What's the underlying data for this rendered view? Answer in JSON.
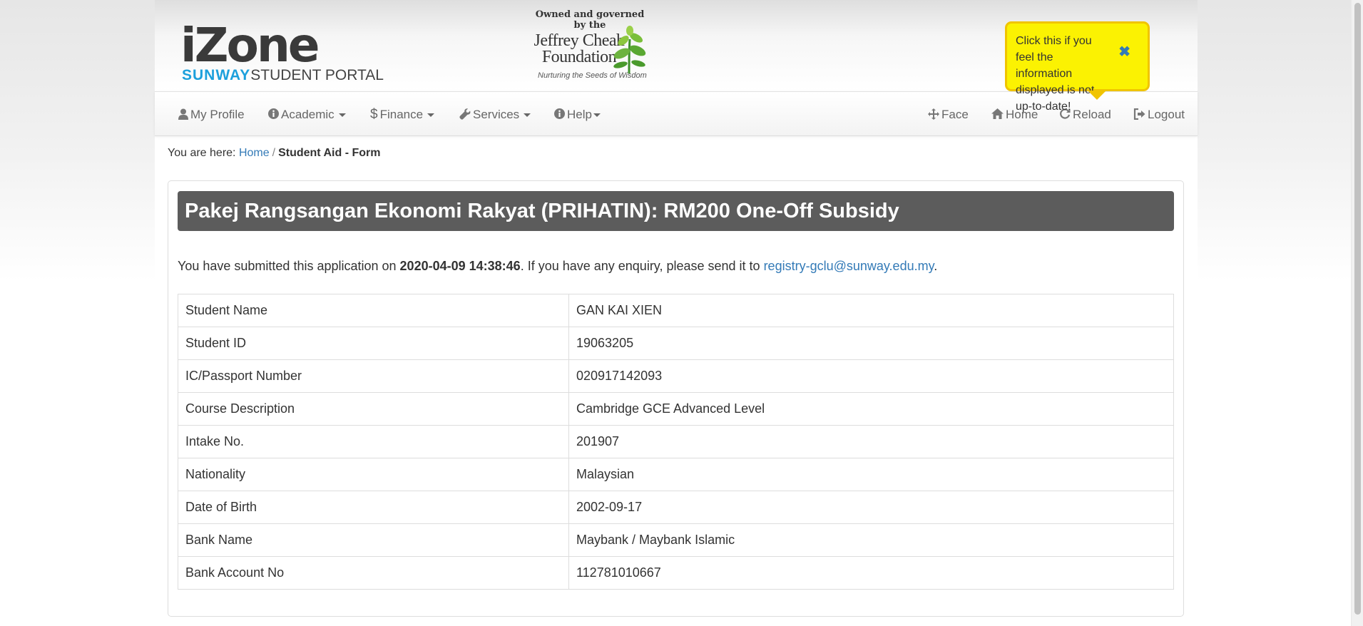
{
  "header": {
    "logo_main": "iZone",
    "logo_sunway": "SUNWAY",
    "logo_portal": "STUDENT PORTAL",
    "jcf_owned": "Owned and governed by the",
    "jcf_name_line1": "Jeffrey Cheah",
    "jcf_name_line2": "Foundation",
    "jcf_tagline": "Nurturing the Seeds of Wisdom"
  },
  "tooltip": {
    "text": "Click this if you feel the information displayed is not up-to-date!",
    "close_glyph": "✖"
  },
  "nav": {
    "left": [
      {
        "label": "My Profile",
        "icon": "user-icon",
        "dropdown": false
      },
      {
        "label": "Academic",
        "icon": "info-circle-icon",
        "dropdown": true
      },
      {
        "label": "Finance",
        "icon": "dollar-icon",
        "dropdown": true
      },
      {
        "label": "Services",
        "icon": "wrench-icon",
        "dropdown": true
      },
      {
        "label": "Help",
        "icon": "info-circle-icon",
        "dropdown": true
      }
    ],
    "right": [
      {
        "label": "Face",
        "icon": "move-icon"
      },
      {
        "label": "Home",
        "icon": "home-icon"
      },
      {
        "label": "Reload",
        "icon": "refresh-icon"
      },
      {
        "label": "Logout",
        "icon": "logout-icon"
      }
    ]
  },
  "breadcrumb": {
    "prefix": "You are here:",
    "home": "Home",
    "separator": "/",
    "current": "Student Aid - Form"
  },
  "form": {
    "title": "Pakej Rangsangan Ekonomi Rakyat (PRIHATIN): RM200 One-Off Subsidy",
    "submitted_prefix": "You have submitted this application on ",
    "submitted_datetime": "2020-04-09 14:38:46",
    "submitted_middle": ". If you have any enquiry, please send it to ",
    "email": "registry-gclu@sunway.edu.my",
    "submitted_suffix": ".",
    "rows": [
      {
        "label": "Student Name",
        "value": "GAN KAI XIEN"
      },
      {
        "label": "Student ID",
        "value": "19063205"
      },
      {
        "label": "IC/Passport Number",
        "value": "020917142093"
      },
      {
        "label": "Course Description",
        "value": "Cambridge GCE Advanced Level"
      },
      {
        "label": "Intake No.",
        "value": "201907"
      },
      {
        "label": "Nationality",
        "value": "Malaysian"
      },
      {
        "label": "Date of Birth",
        "value": "2002-09-17"
      },
      {
        "label": "Bank Name",
        "value": "Maybank / Maybank Islamic"
      },
      {
        "label": "Bank Account No",
        "value": "112781010667"
      }
    ]
  },
  "colors": {
    "accent": "#337ab7",
    "logo_blue": "#1ca0dc",
    "tooltip_bg": "#fbf202",
    "tooltip_border": "#f0c400",
    "title_bar": "#5c5c5c"
  }
}
